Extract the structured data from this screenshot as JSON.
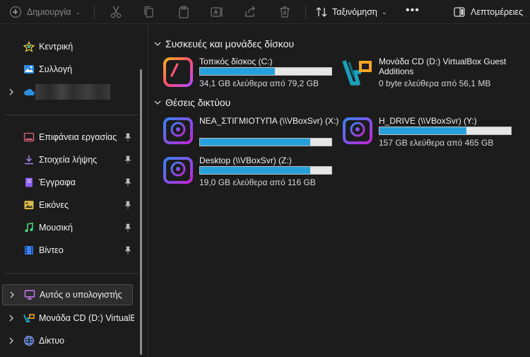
{
  "toolbar": {
    "new_label": "Δημιουργία",
    "sort_label": "Ταξινόμηση",
    "details_label": "Λεπτομέρειες",
    "icons": [
      "cut-icon",
      "copy-icon",
      "paste-icon",
      "rename-icon",
      "share-icon",
      "delete-icon"
    ]
  },
  "sidebar": {
    "top": [
      {
        "label": "Κεντρική",
        "icon": "home-icon"
      },
      {
        "label": "Συλλογή",
        "icon": "gallery-icon"
      },
      {
        "label": "",
        "icon": "onedrive-cloud-icon"
      }
    ],
    "quick_access": [
      {
        "label": "Επιφάνεια εργασίας",
        "icon": "desktop-folder-icon",
        "pinned": true
      },
      {
        "label": "Στοιχεία λήψης",
        "icon": "downloads-icon",
        "pinned": true
      },
      {
        "label": "Έγγραφα",
        "icon": "documents-icon",
        "pinned": true
      },
      {
        "label": "Εικόνες",
        "icon": "pictures-icon",
        "pinned": true
      },
      {
        "label": "Μουσική",
        "icon": "music-icon",
        "pinned": true
      },
      {
        "label": "Βίντεο",
        "icon": "videos-icon",
        "pinned": true
      }
    ],
    "bottom": [
      {
        "label": "Αυτός ο υπολογιστής",
        "icon": "this-pc-icon",
        "selected": true
      },
      {
        "label": "Μονάδα CD (D:) VirtualBox Guest Additions",
        "icon": "virtualbox-cd-icon"
      },
      {
        "label": "Δίκτυο",
        "icon": "network-icon"
      }
    ]
  },
  "main": {
    "devices_title": "Συσκευές και μονάδες δίσκου",
    "network_title": "Θέσεις δικτύου",
    "devices": [
      {
        "name": "Τοπικός δίσκος (C:)",
        "free": "34,1 GB ελεύθερα από 79,2 GB",
        "used_fraction": 0.57,
        "icon": "local-disk-icon",
        "has_bar": true
      },
      {
        "name": "Μονάδα CD (D:) VirtualBox Guest Additions",
        "free": "0 byte ελεύθερα από 56,1 MB",
        "icon": "virtualbox-cd-icon",
        "has_bar": false
      }
    ],
    "network": [
      {
        "name": "ΝΕΑ_ΣΤΙΓΜΙΟΤΥΠΑ (\\\\VBoxSvr) (X:)",
        "free": "",
        "used_fraction": 0.84,
        "icon": "network-drive-icon"
      },
      {
        "name": "H_DRIVE (\\\\VBoxSvr) (Y:)",
        "free": "157 GB ελεύθερα από 465 GB",
        "used_fraction": 0.66,
        "icon": "network-drive-icon"
      },
      {
        "name": "Desktop (\\\\VBoxSvr) (Z:)",
        "free": "19,0 GB ελεύθερα από 116 GB",
        "used_fraction": 0.84,
        "icon": "network-drive-icon"
      }
    ]
  },
  "colors": {
    "background": "#1c1c1c",
    "bar_fill": "#26a0da",
    "bar_track": "#e6e6e6",
    "selected_bg": "#2d2d2d"
  }
}
